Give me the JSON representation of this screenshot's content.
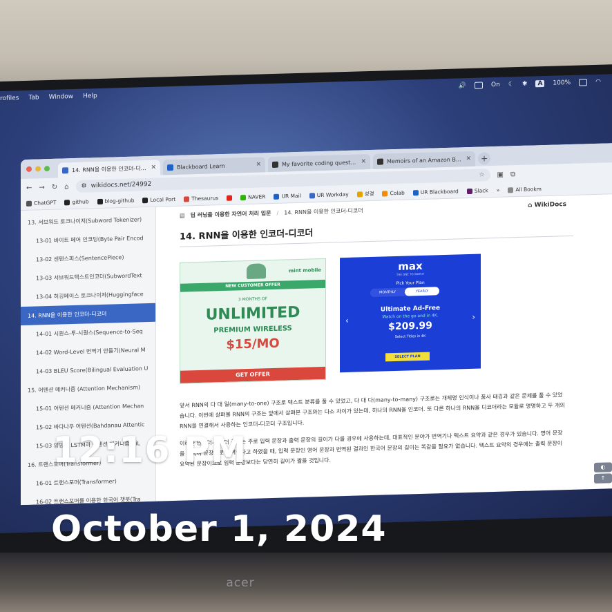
{
  "menubar": {
    "items": [
      "rofiles",
      "Tab",
      "Window",
      "Help"
    ],
    "status": {
      "input_source": "A",
      "battery": "100%",
      "focus": "On"
    }
  },
  "tabs": [
    {
      "label": "14. RNN을 이용한 인코더-디코더",
      "color": "#3b67c4"
    },
    {
      "label": "Blackboard Learn",
      "color": "#1e62c7"
    },
    {
      "label": "My favorite coding question t",
      "color": "#333333"
    },
    {
      "label": "Memoirs of an Amazon Bar Ra",
      "color": "#333333"
    }
  ],
  "address": {
    "url": "wikidocs.net/24992"
  },
  "bookmarks": [
    {
      "label": "ChatGPT",
      "color": "#555555"
    },
    {
      "label": "github",
      "color": "#222222"
    },
    {
      "label": "blog-github",
      "color": "#222222"
    },
    {
      "label": "Local Port",
      "color": "#222222"
    },
    {
      "label": "Thesaurus",
      "color": "#d9473d"
    },
    {
      "label": "NAVER",
      "color": "#2db400"
    },
    {
      "label": "UR Mail",
      "color": "#1e62c7"
    },
    {
      "label": "UR Workday",
      "color": "#3b67c4"
    },
    {
      "label": "성경",
      "color": "#e2a400"
    },
    {
      "label": "Colab",
      "color": "#f28b00"
    },
    {
      "label": "UR Blackboard",
      "color": "#1e62c7"
    },
    {
      "label": "Slack",
      "color": "#611f69"
    },
    {
      "label": "All Bookm",
      "color": "#555555"
    }
  ],
  "sidebar": {
    "items": [
      {
        "label": "13. 서브워드 토크나이저(Subword Tokenizer)",
        "level": 1
      },
      {
        "label": "13-01 바이트 페어 인코딩(Byte Pair Encod",
        "level": 2
      },
      {
        "label": "13-02 센텐스피스(SentencePiece)",
        "level": 2
      },
      {
        "label": "13-03 서브워드텍스트인코더(SubwordText",
        "level": 2
      },
      {
        "label": "13-04 허깅페이스 토크나이저(Huggingface",
        "level": 2
      },
      {
        "label": "14. RNN을 이용한 인코더-디코더",
        "level": 1,
        "active": true
      },
      {
        "label": "14-01 시퀀스-투-시퀀스(Sequence-to-Seq",
        "level": 2
      },
      {
        "label": "14-02 Word-Level 번역기 만들기(Neural M",
        "level": 2
      },
      {
        "label": "14-03 BLEU Score(Bilingual Evaluation U",
        "level": 2
      },
      {
        "label": "15. 어텐션 메커니즘 (Attention Mechanism)",
        "level": 1
      },
      {
        "label": "15-01 어텐션 메커니즘 (Attention Mechan",
        "level": 2
      },
      {
        "label": "15-02 바다나우 어텐션(Bahdanau Attentic",
        "level": 2
      },
      {
        "label": "15-03 양방향 LSTM과 어텐션 메커니즘(BiL",
        "level": 2
      },
      {
        "label": "16. 트랜스포머(Transformer)",
        "level": 1
      },
      {
        "label": "16-01 트랜스포머(Transformer)",
        "level": 2
      },
      {
        "label": "16-02 트랜스포머를 이용한 한국어 챗봇(Tra",
        "level": 2
      }
    ]
  },
  "content": {
    "breadcrumb_book": "딥 러닝을 이용한 자연어 처리 입문",
    "breadcrumb_page": "14. RNN을 이용한 인코더-디코더",
    "site": "WikiDocs",
    "title": "14. RNN을 이용한 인코더-디코더",
    "paragraph1": "앞서 RNN의 다 대 일(many-to-one) 구조로 텍스트 분류를 풀 수 있었고, 다 대 다(many-to-many) 구조로는 개체명 인식이나 품사 태깅과 같은 문제를 풀 수 있었습니다. 이번에 살펴볼 RNN의 구조는 앞에서 살펴본 구조와는 다소 차이가 있는데, 하나의 RNN을 인코더. 또 다른 하나의 RNN을 디코더라는 모듈로 명명하고 두 개의 RNN을 연결해서 사용하는 인코더-디코더 구조입니다.",
    "paragraph2": "이러한 인코더-디코더 구조는 주로 입력 문장과 출력 문장의 길이가 다를 경우에 사용하는데, 대표적인 분야가 번역기나 텍스트 요약과 같은 경우가 있습니다. 영어 문장을 한국어 문장으로 번역한다고 하였을 때, 입력 문장인 영어 문장과 번역된 결과인 한국어 문장의 길이는 똑같을 필요가 없습니다. 텍스트 요약의 경우에는 출력 문장이 요약된 문장이므로 입력 문장보다는 당연히 길이가 짧을 것입니다."
  },
  "ad_mint": {
    "brand": "mint mobile",
    "banner": "NEW CUSTOMER OFFER",
    "months": "3 MONTHS OF",
    "headline": "UNLIMITED",
    "sub": "PREMIUM WIRELESS",
    "price": "$15/MO",
    "cta": "GET OFFER"
  },
  "ad_max": {
    "brand": "max",
    "tag": "THE ONE TO WATCH",
    "pick": "Pick Your Plan",
    "monthly": "MONTHLY",
    "yearly": "YEARLY",
    "plan": "Ultimate Ad-Free",
    "watch": "Watch on the go and in 4K.",
    "price": "$209.99",
    "titles": "Select Titles in 4K",
    "cta": "SELECT PLAN"
  },
  "overlay": {
    "time": "12:16 PM",
    "date": "October 1, 2024"
  },
  "monitor_brand": "acer"
}
